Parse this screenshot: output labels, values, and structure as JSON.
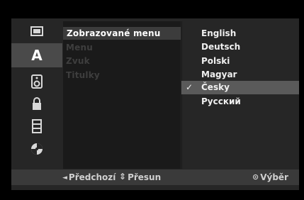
{
  "sidebar": {
    "items": [
      {
        "icon": "disc-icon"
      },
      {
        "icon": "language-icon",
        "label": "A"
      },
      {
        "icon": "speaker-icon"
      },
      {
        "icon": "lock-icon"
      },
      {
        "icon": "film-icon"
      },
      {
        "icon": "setup-disc-icon"
      }
    ]
  },
  "submenu": {
    "items": [
      {
        "label": "Zobrazované menu",
        "selected": true
      },
      {
        "label": "Menu"
      },
      {
        "label": "Zvuk"
      },
      {
        "label": "Titulky"
      }
    ]
  },
  "options": {
    "items": [
      {
        "label": "English"
      },
      {
        "label": "Deutsch"
      },
      {
        "label": "Polski"
      },
      {
        "label": "Magyar"
      },
      {
        "label": "Česky",
        "selected": true,
        "check": "✓"
      },
      {
        "label": "Русский"
      }
    ]
  },
  "footer": {
    "prev_icon": "◄",
    "prev_label": "Předchozí",
    "move_icon": "⇕",
    "move_label": "Přesun",
    "select_icon": "⊙",
    "select_label": "Výběr"
  }
}
